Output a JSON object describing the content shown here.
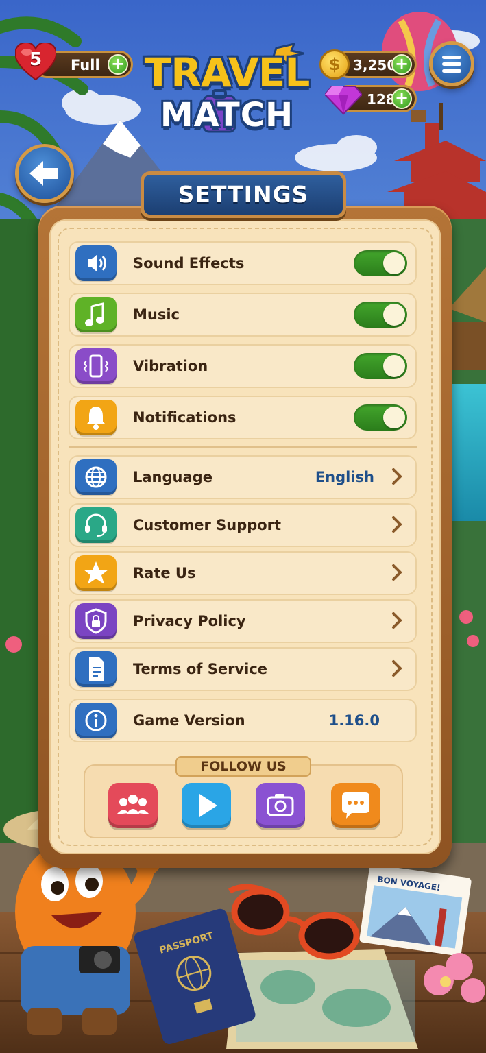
{
  "game": {
    "logo_line1": "TRAVEL",
    "logo_line2": "MATCH"
  },
  "hud": {
    "lives_count": "5",
    "lives_status": "Full",
    "coins": "3,250",
    "gems": "128",
    "plus_symbol": "+"
  },
  "settings": {
    "title": "SETTINGS",
    "toggles": [
      {
        "label": "Sound Effects",
        "icon": "speaker-icon",
        "on": true,
        "color": "#2f6fc0"
      },
      {
        "label": "Music",
        "icon": "music-note-icon",
        "on": true,
        "color": "#5fb227"
      },
      {
        "label": "Vibration",
        "icon": "phone-vibrate-icon",
        "on": true,
        "color": "#8a4cc8"
      },
      {
        "label": "Notifications",
        "icon": "bell-icon",
        "on": true,
        "color": "#f2a515"
      }
    ],
    "links": [
      {
        "label": "Language",
        "value": "English",
        "icon": "globe-icon",
        "color": "#2f6fc0"
      },
      {
        "label": "Customer Support",
        "icon": "headset-icon",
        "color": "#2aa887"
      },
      {
        "label": "Rate Us",
        "icon": "star-icon",
        "color": "#f2a515"
      },
      {
        "label": "Privacy Policy",
        "icon": "shield-lock-icon",
        "color": "#7b44c2"
      },
      {
        "label": "Terms of Service",
        "icon": "document-icon",
        "color": "#2f6fc0"
      }
    ],
    "version": {
      "label": "Game Version",
      "value": "1.16.0",
      "icon": "info-icon",
      "color": "#2f6fc0"
    }
  },
  "follow": {
    "label": "FOLLOW US",
    "buttons": [
      {
        "icon": "community-icon",
        "color": "#e44a5a"
      },
      {
        "icon": "play-icon",
        "color": "#2aa5e6"
      },
      {
        "icon": "camera-icon",
        "color": "#8a52d2"
      },
      {
        "icon": "chat-bubble-icon",
        "color": "#f08a1c"
      }
    ]
  },
  "decor": {
    "passport_text": "PASSPORT",
    "postcard_text": "BON VOYAGE!"
  }
}
